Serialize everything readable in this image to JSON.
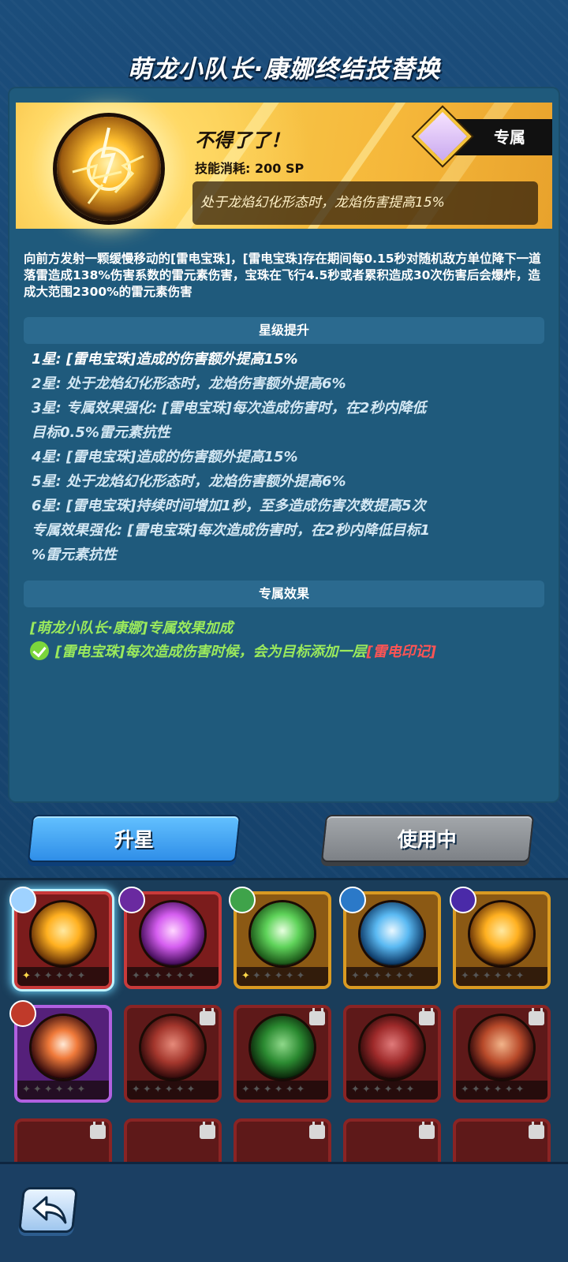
{
  "header": {
    "title": "萌龙小队长·康娜终结技替换"
  },
  "skill": {
    "name": "不得了了！",
    "cost_label": "技能消耗: 200 SP",
    "passive": "处于龙焰幻化形态时，龙焰伤害提高15%",
    "exclusive_label": "专属",
    "orb_color": "#ffbf2e"
  },
  "description": "向前方发射一颗缓慢移动的[雷电宝珠]，[雷电宝珠]存在期间每0.15秒对随机敌方单位降下一道落雷造成138%伤害系数的雷元素伤害，宝珠在飞行4.5秒或者累积造成30次伤害后会爆炸，造成大范围2300%的雷元素伤害",
  "star_section": {
    "title": "星级提升",
    "lines": [
      "1星: [雷电宝珠]造成的伤害额外提高15%",
      "2星: 处于龙焰幻化形态时，龙焰伤害额外提高6%",
      "3星: 专属效果强化: [雷电宝珠]每次造成伤害时，在2秒内降低",
      "目标0.5%雷元素抗性",
      "4星: [雷电宝珠]造成的伤害额外提高15%",
      "5星: 处于龙焰幻化形态时，龙焰伤害额外提高6%",
      "6星: [雷电宝珠]持续时间增加1秒，至多造成伤害次数提高5次",
      "专属效果强化: [雷电宝珠]每次造成伤害时，在2秒内降低目标1",
      "%雷元素抗性"
    ]
  },
  "exclusive_section": {
    "title": "专属效果",
    "bonus_title": "[萌龙小队长·康娜]专属效果加成",
    "effect_text": "[雷电宝珠]每次造成伤害时候，会为目标添加一层",
    "effect_highlight": "[雷电印记]"
  },
  "buttons": {
    "upgrade": "升星",
    "in_use": "使用中"
  },
  "skill_cards_row1": [
    {
      "icon": "lightning-orb-icon",
      "stars": 1,
      "frame": "red",
      "selected": true,
      "badge": "#9fd2ff"
    },
    {
      "icon": "purple-orb-icon",
      "stars": 0,
      "frame": "red",
      "selected": false,
      "badge": "#6a2aa0"
    },
    {
      "icon": "green-arrow-icon",
      "stars": 1,
      "frame": "gold",
      "selected": false,
      "badge": "#3fa34a"
    },
    {
      "icon": "ice-shard-icon",
      "stars": 0,
      "frame": "gold",
      "selected": false,
      "badge": "#2b79c8"
    },
    {
      "icon": "gold-claw-icon",
      "stars": 0,
      "frame": "gold",
      "selected": false,
      "badge": "#4a2aa8"
    }
  ],
  "skill_cards_row2": [
    {
      "icon": "flame-wisp-icon",
      "locked": false,
      "frame": "purple",
      "badge": "#c03a2a"
    },
    {
      "icon": "explosion-icon",
      "locked": true,
      "frame": "locked"
    },
    {
      "icon": "green-shadow-icon",
      "locked": true,
      "frame": "locked"
    },
    {
      "icon": "rune-icon",
      "locked": true,
      "frame": "locked"
    },
    {
      "icon": "sword-burst-icon",
      "locked": true,
      "frame": "locked"
    }
  ]
}
